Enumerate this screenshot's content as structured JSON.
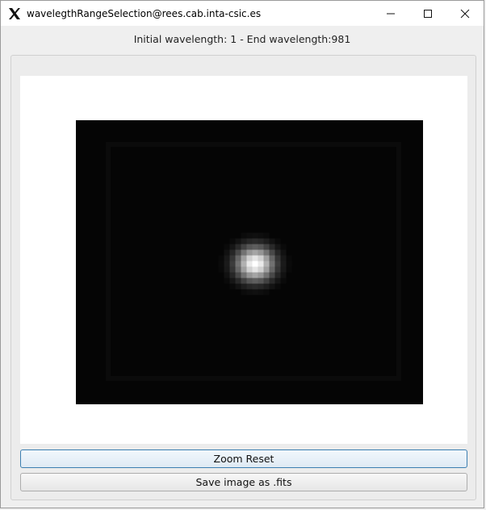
{
  "window": {
    "title": "wavelegthRangeSelection@rees.cab.inta-csic.es",
    "app_icon": "x-logo-icon",
    "controls": [
      "minimize-icon",
      "maximize-icon",
      "close-icon"
    ]
  },
  "info": {
    "text": "Initial wavelength: 1 - End wavelength:981"
  },
  "image": {
    "description_colormap": "grayscale",
    "background_color": "#050505",
    "source_peak_color": "#ffffff"
  },
  "buttons": {
    "zoom_reset": "Zoom Reset",
    "save_image": "Save image as .fits"
  }
}
